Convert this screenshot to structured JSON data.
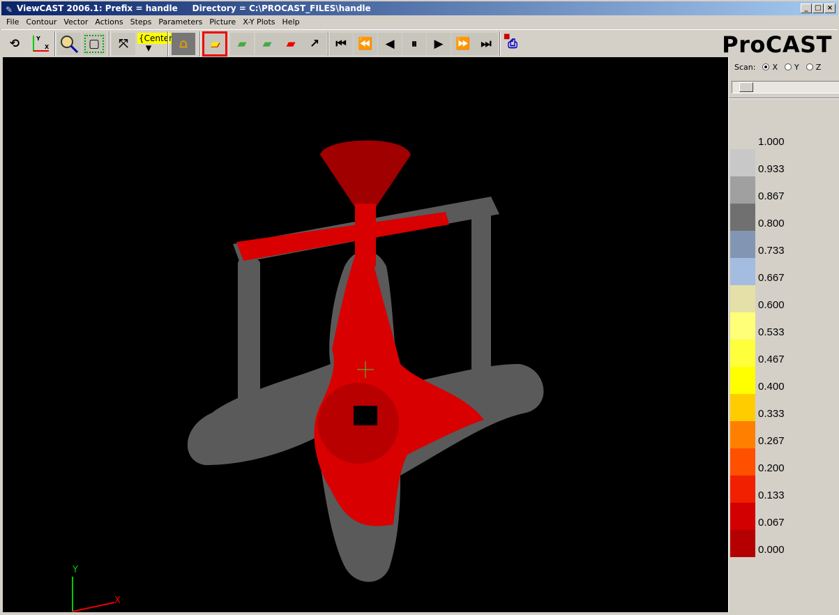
{
  "window": {
    "title": "ViewCAST 2006.1: Prefix = handle     Directory = C:\\PROCAST_FILES\\handle",
    "controls": [
      "_",
      "□",
      "×"
    ]
  },
  "menu": [
    "File",
    "Contour",
    "Vector",
    "Actions",
    "Steps",
    "Parameters",
    "Picture",
    "X-Y Plots",
    "Help"
  ],
  "toolbar": {
    "tooltip": "{Center}",
    "logo": "ProCAST",
    "icons": [
      "rotate-icon",
      "axes-icon",
      "zoom-icon",
      "bounding-box-icon",
      "center-icon",
      "center-dropdown-icon",
      "mold-view-icon",
      "solid-contour-icon",
      "cut-plane-icon",
      "cut-plane-move-icon",
      "cut-solid-icon",
      "point-probe-icon",
      "first-step-icon",
      "rewind-icon",
      "step-back-icon",
      "pause-icon",
      "play-icon",
      "fast-forward-icon",
      "last-step-icon",
      "save-print-icon"
    ]
  },
  "panel": {
    "scan_label": "Scan:",
    "scan_options": [
      "X",
      "Y",
      "Z"
    ],
    "scan_selected": "X",
    "slider_value": 0
  },
  "legend": {
    "labels": [
      "1.000",
      "0.933",
      "0.867",
      "0.800",
      "0.733",
      "0.667",
      "0.600",
      "0.533",
      "0.467",
      "0.400",
      "0.333",
      "0.267",
      "0.200",
      "0.133",
      "0.067",
      "0.000"
    ],
    "colors": [
      "#c8c8c8",
      "#a0a0a0",
      "#707070",
      "#8296b4",
      "#a4bce0",
      "#e4e0a8",
      "#ffff78",
      "#ffff3c",
      "#ffff00",
      "#ffcc00",
      "#ff8000",
      "#ff5000",
      "#f02000",
      "#d20000",
      "#b40000"
    ]
  },
  "viewport": {
    "axis_x": "X",
    "axis_y": "Y",
    "colors": {
      "solid": "#5a5a5a",
      "liquid": "#d80000"
    }
  }
}
